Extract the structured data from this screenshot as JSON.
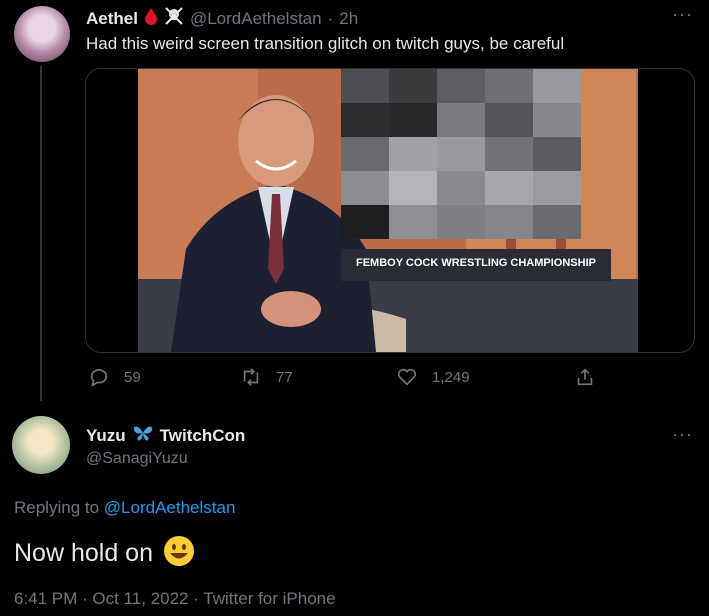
{
  "tweet": {
    "author_name": "Aethel",
    "handle": "@LordAethelstan",
    "time": "2h",
    "text": "Had this weird screen transition glitch on twitch guys, be careful",
    "media_caption": "FEMBOY COCK WRESTLING CHAMPIONSHIP",
    "replies": "59",
    "retweets": "77",
    "likes": "1,249"
  },
  "reply": {
    "author_name": "Yuzu",
    "author_suffix": "TwitchCon",
    "handle": "@SanagiYuzu",
    "replying_prefix": "Replying to",
    "replying_handle": "@LordAethelstan",
    "text": "Now hold on",
    "timestamp": "6:41 PM · Oct 11, 2022 · Twitter for iPhone"
  },
  "icons": {
    "more": "more-icon",
    "reply": "reply-icon",
    "retweet": "retweet-icon",
    "like": "heart-icon",
    "share": "share-icon",
    "blood_drop": "blood-drop-icon",
    "skull": "skull-crossbones-icon",
    "butterfly": "butterfly-icon",
    "emoji": "grinning-face-icon"
  },
  "colors": {
    "background": "#000000",
    "text": "#e7e9ea",
    "muted": "#71767b",
    "link": "#1d9bf0"
  }
}
